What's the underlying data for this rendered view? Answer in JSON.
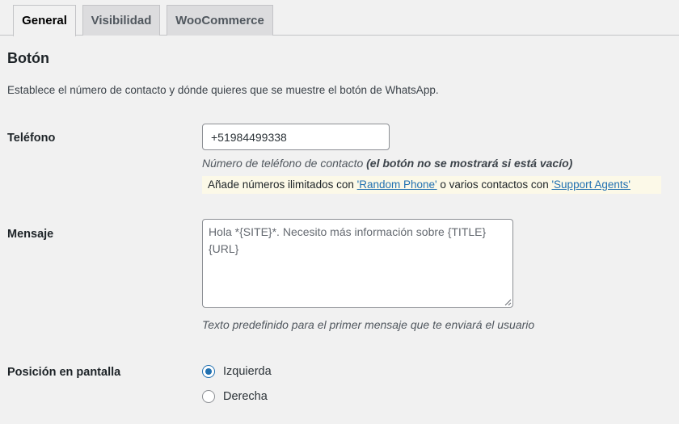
{
  "tabs": [
    {
      "label": "General",
      "active": true
    },
    {
      "label": "Visibilidad",
      "active": false
    },
    {
      "label": "WooCommerce",
      "active": false
    }
  ],
  "section": {
    "title": "Botón",
    "description": "Establece el número de contacto y dónde quieres que se muestre el botón de WhatsApp."
  },
  "telefono": {
    "label": "Teléfono",
    "value": "+51984499338",
    "help_prefix": "Número de teléfono de contacto",
    "help_bold": "(el botón no se mostrará si está vacío)",
    "notice_prefix": "Añade números ilimitados con",
    "notice_link1": "'Random Phone'",
    "notice_middle": "o varios contactos con",
    "notice_link2": "'Support Agents'"
  },
  "mensaje": {
    "label": "Mensaje",
    "value": "Hola *{SITE}*. Necesito más información sobre {TITLE} {URL}",
    "help": "Texto predefinido para el primer mensaje que te enviará el usuario"
  },
  "posicion": {
    "label": "Posición en pantalla",
    "options": [
      "Izquierda",
      "Derecha"
    ],
    "selected": "Izquierda"
  },
  "colors": {
    "accent": "#2271b1",
    "background": "#f1f1f1",
    "notice_bg": "#fcf9e8"
  },
  "icons": {
    "resize": "resize-grip-icon"
  }
}
